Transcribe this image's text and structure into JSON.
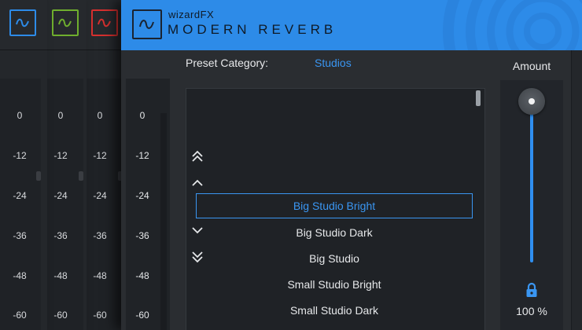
{
  "colors": {
    "accent": "#3a96f2",
    "header": "#2d8be8",
    "window_logos": [
      "#2d8be8",
      "#6fae2e",
      "#d6302f"
    ]
  },
  "background_windows": [
    {
      "logo_icon": "wave-logo-icon",
      "logo_color": "#2d8be8",
      "scale": [
        "0",
        "-12",
        "-24",
        "-36",
        "-48",
        "-60"
      ]
    },
    {
      "logo_icon": "wave-logo-icon",
      "logo_color": "#6fae2e",
      "scale": [
        "0",
        "-12",
        "-24",
        "-36",
        "-48",
        "-60"
      ]
    },
    {
      "logo_icon": "wave-logo-icon",
      "logo_color": "#d6302f",
      "scale": [
        "0",
        "-12",
        "-24",
        "-36",
        "-48",
        "-60"
      ]
    }
  ],
  "header": {
    "brand": "wizardFX",
    "product": "MODERN REVERB"
  },
  "meter": {
    "scale": [
      "0",
      "-12",
      "-24",
      "-36",
      "-48",
      "-60"
    ]
  },
  "preset": {
    "category_label": "Preset Category:",
    "category_value": "Studios",
    "nav_icons": [
      "double-chevron-up-icon",
      "chevron-up-icon",
      "chevron-down-icon",
      "double-chevron-down-icon"
    ],
    "items": [
      "Big Studio Bright",
      "Big Studio Dark",
      "Big Studio",
      "Small Studio Bright",
      "Small Studio Dark"
    ],
    "selected_index": 0
  },
  "amount": {
    "label": "Amount",
    "value_text": "100 %",
    "value": 1.0
  }
}
